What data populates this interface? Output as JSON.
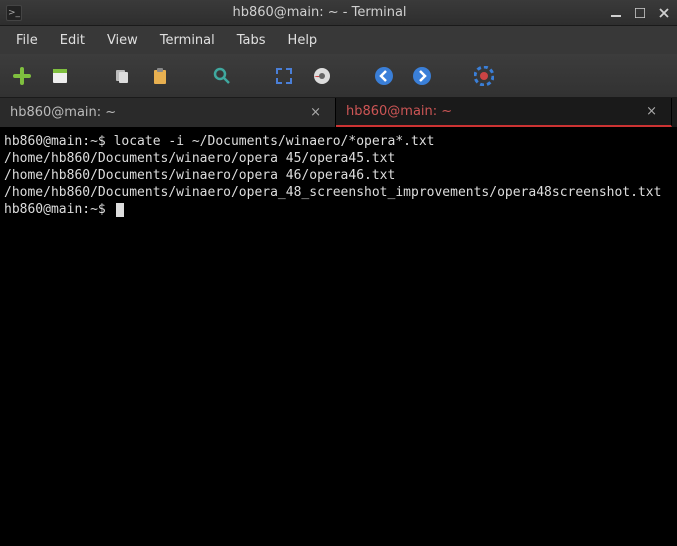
{
  "titlebar": {
    "title": "hb860@main: ~ - Terminal",
    "icon_glyph": ">_"
  },
  "menubar": {
    "items": [
      "File",
      "Edit",
      "View",
      "Terminal",
      "Tabs",
      "Help"
    ]
  },
  "toolbar": {
    "icons": [
      "new-tab",
      "new-window",
      "copy",
      "paste",
      "search",
      "fullscreen",
      "preferences",
      "back",
      "forward",
      "help"
    ]
  },
  "tabs": [
    {
      "label": "hb860@main: ~",
      "active": false
    },
    {
      "label": "hb860@main: ~",
      "active": true
    }
  ],
  "terminal": {
    "prompt": "hb860@main:~$",
    "command": "locate -i ~/Documents/winaero/*opera*.txt",
    "output": [
      "/home/hb860/Documents/winaero/opera 45/opera45.txt",
      "/home/hb860/Documents/winaero/opera 46/opera46.txt",
      "/home/hb860/Documents/winaero/opera_48_screenshot_improvements/opera48screenshot.txt"
    ],
    "prompt2": "hb860@main:~$"
  }
}
